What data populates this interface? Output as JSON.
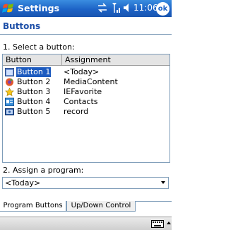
{
  "titlebar": {
    "title": "Settings",
    "time": "11:06",
    "ok_label": "ok"
  },
  "page": {
    "title": "Buttons",
    "select_label": "1. Select a button:",
    "assign_label": "2. Assign a program:"
  },
  "list": {
    "columns": [
      "Button",
      "Assignment"
    ],
    "rows": [
      {
        "name": "Button 1",
        "assignment": "<Today>",
        "icon": "today-calendar-icon",
        "selected": true
      },
      {
        "name": "Button 2",
        "assignment": "MediaContent",
        "icon": "media-player-icon",
        "selected": false
      },
      {
        "name": "Button 3",
        "assignment": "IEFavorite",
        "icon": "favorites-star-icon",
        "selected": false
      },
      {
        "name": "Button 4",
        "assignment": "Contacts",
        "icon": "contacts-card-icon",
        "selected": false
      },
      {
        "name": "Button 5",
        "assignment": "record",
        "icon": "record-icon",
        "selected": false
      }
    ]
  },
  "program_select": {
    "value": "<Today>"
  },
  "tabs": [
    {
      "label": "Program Buttons",
      "active": true
    },
    {
      "label": "Up/Down Control",
      "active": false
    }
  ],
  "colors": {
    "titlebar": "#1d63c6",
    "selection": "#1d5bbf",
    "page_title": "#1d4fa8"
  }
}
